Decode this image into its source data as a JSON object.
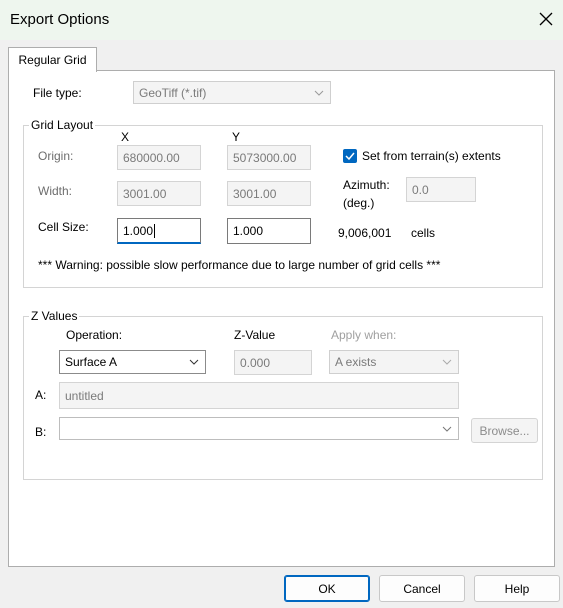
{
  "window": {
    "title": "Export Options"
  },
  "tabs": [
    {
      "label": "Regular Grid"
    }
  ],
  "file_type": {
    "label": "File type:",
    "value": "GeoTiff (*.tif)"
  },
  "grid_layout": {
    "title": "Grid Layout",
    "col_x": "X",
    "col_y": "Y",
    "origin": {
      "label": "Origin:",
      "x": "680000.00",
      "y": "5073000.00"
    },
    "width": {
      "label": "Width:",
      "x": "3001.00",
      "y": "3001.00"
    },
    "cell_size": {
      "label": "Cell Size:",
      "x": "1.000",
      "y": "1.000"
    },
    "set_from_terrain": {
      "label": "Set from terrain(s) extents",
      "checked": true
    },
    "azimuth": {
      "label_line1": "Azimuth:",
      "label_line2": "(deg.)",
      "value": "0.0"
    },
    "cells": {
      "count": "9,006,001",
      "unit": "cells"
    },
    "warning": "*** Warning: possible slow performance due to large number of grid cells ***"
  },
  "z_values": {
    "title": "Z Values",
    "operation_label": "Operation:",
    "operation_value": "Surface A",
    "zvalue_label": "Z-Value",
    "zvalue_value": "0.000",
    "apply_when_label": "Apply when:",
    "apply_when_value": "A exists",
    "a_label": "A:",
    "a_value": "untitled",
    "b_label": "B:",
    "b_value": "",
    "browse_label": "Browse..."
  },
  "buttons": {
    "ok": "OK",
    "cancel": "Cancel",
    "help": "Help"
  },
  "colors": {
    "accent": "#0067c0",
    "title_bar": "#eef6ee"
  }
}
